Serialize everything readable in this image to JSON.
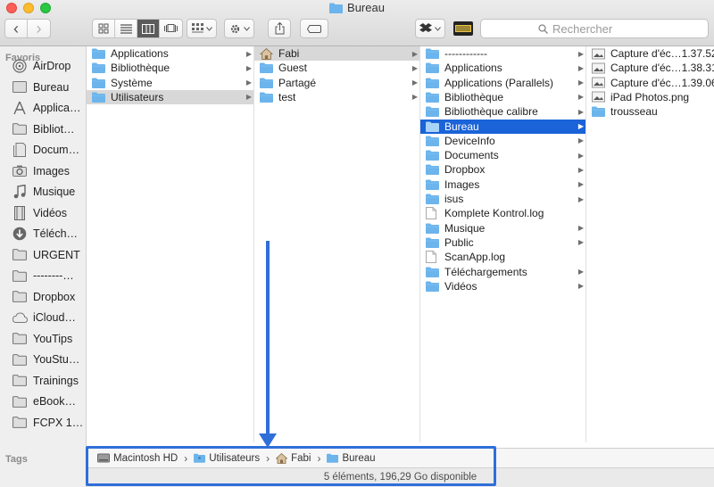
{
  "window": {
    "title": "Bureau"
  },
  "toolbar": {
    "back_glyph": "‹",
    "forward_glyph": "›",
    "search_placeholder": "Rechercher"
  },
  "sidebar": {
    "favorites_heading": "Favoris",
    "tags_heading": "Tags",
    "items": [
      {
        "label": "AirDrop",
        "icon": "airdrop-icon"
      },
      {
        "label": "Bureau",
        "icon": "desktop-icon"
      },
      {
        "label": "Applica…",
        "icon": "applications-icon"
      },
      {
        "label": "Bibliot…",
        "icon": "folder-icon"
      },
      {
        "label": "Docum…",
        "icon": "documents-icon"
      },
      {
        "label": "Images",
        "icon": "camera-icon"
      },
      {
        "label": "Musique",
        "icon": "music-icon"
      },
      {
        "label": "Vidéos",
        "icon": "film-icon"
      },
      {
        "label": "Téléch…",
        "icon": "download-icon"
      },
      {
        "label": "URGENT",
        "icon": "folder-icon"
      },
      {
        "label": "--------…",
        "icon": "folder-icon"
      },
      {
        "label": "Dropbox",
        "icon": "folder-icon"
      },
      {
        "label": "iCloud…",
        "icon": "cloud-icon"
      },
      {
        "label": "YouTips",
        "icon": "folder-icon"
      },
      {
        "label": "YouStu…",
        "icon": "folder-icon"
      },
      {
        "label": "Trainings",
        "icon": "folder-icon"
      },
      {
        "label": "eBook…",
        "icon": "folder-icon"
      },
      {
        "label": "FCPX 1…",
        "icon": "folder-icon"
      }
    ]
  },
  "columns": {
    "col1": [
      {
        "name": "Applications",
        "arrow": true
      },
      {
        "name": "Bibliothèque",
        "arrow": true
      },
      {
        "name": "Système",
        "arrow": true
      },
      {
        "name": "Utilisateurs",
        "arrow": true,
        "selected": true
      }
    ],
    "col2": [
      {
        "name": "Fabi",
        "arrow": true,
        "selected": true,
        "home": true
      },
      {
        "name": "Guest",
        "arrow": true
      },
      {
        "name": "Partagé",
        "arrow": true
      },
      {
        "name": "test",
        "arrow": true
      }
    ],
    "col3": [
      {
        "name": "------------",
        "arrow": true
      },
      {
        "name": "Applications",
        "arrow": true
      },
      {
        "name": "Applications (Parallels)",
        "arrow": true
      },
      {
        "name": "Bibliothèque",
        "arrow": true
      },
      {
        "name": "Bibliothèque calibre",
        "arrow": true
      },
      {
        "name": "Bureau",
        "arrow": true,
        "active": true
      },
      {
        "name": "DeviceInfo",
        "arrow": true
      },
      {
        "name": "Documents",
        "arrow": true
      },
      {
        "name": "Dropbox",
        "arrow": true
      },
      {
        "name": "Images",
        "arrow": true
      },
      {
        "name": "isus",
        "arrow": true
      },
      {
        "name": "Komplete Kontrol.log",
        "arrow": false,
        "file": true
      },
      {
        "name": "Musique",
        "arrow": true
      },
      {
        "name": "Public",
        "arrow": true
      },
      {
        "name": "ScanApp.log",
        "arrow": false,
        "file": true
      },
      {
        "name": "Téléchargements",
        "arrow": true
      },
      {
        "name": "Vidéos",
        "arrow": true
      }
    ],
    "col4": [
      {
        "name": "Capture d'éc…1.37.52",
        "image": true
      },
      {
        "name": "Capture d'éc…1.38.31",
        "image": true
      },
      {
        "name": "Capture d'éc…1.39.06",
        "image": true
      },
      {
        "name": "iPad Photos.png",
        "image": true
      },
      {
        "name": "trousseau",
        "folder": true
      }
    ]
  },
  "pathbar": {
    "crumbs": [
      "Macintosh HD",
      "Utilisateurs",
      "Fabi",
      "Bureau"
    ],
    "separator": "›"
  },
  "status": {
    "text": "5 éléments, 196,29 Go disponible"
  },
  "colors": {
    "selection_blue": "#1a63d8",
    "annotation_blue": "#2f6fd8",
    "folder_blue": "#6cb4ec"
  }
}
